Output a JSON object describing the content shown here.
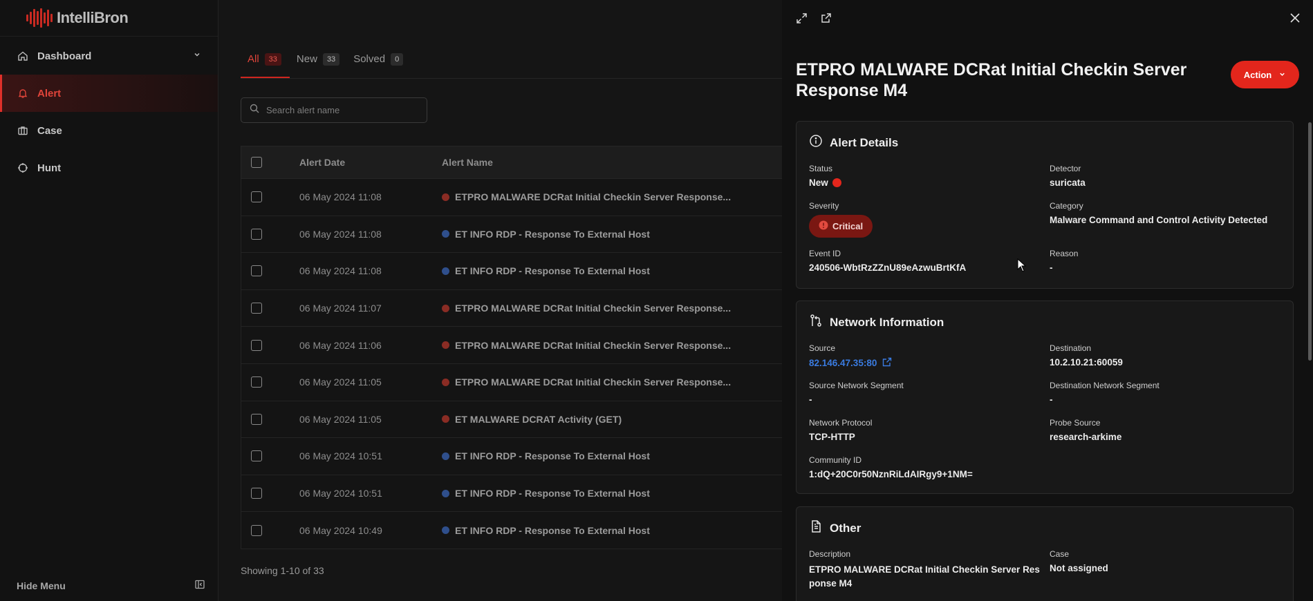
{
  "sidebar": {
    "logo_text": "IntelliBron",
    "items": [
      {
        "label": "Dashboard",
        "icon": "home-icon"
      },
      {
        "label": "Alert",
        "icon": "bell-icon"
      },
      {
        "label": "Case",
        "icon": "briefcase-icon"
      },
      {
        "label": "Hunt",
        "icon": "crosshair-icon"
      }
    ],
    "hide_menu": "Hide Menu"
  },
  "tabs": [
    {
      "label": "All",
      "count": "33"
    },
    {
      "label": "New",
      "count": "33"
    },
    {
      "label": "Solved",
      "count": "0"
    }
  ],
  "search": {
    "placeholder": "Search alert name"
  },
  "table": {
    "headers": {
      "date": "Alert Date",
      "name": "Alert Name"
    },
    "rows": [
      {
        "date": "06 May 2024 11:08",
        "name": "ETPRO MALWARE DCRat Initial Checkin Server Response...",
        "severity": "critical"
      },
      {
        "date": "06 May 2024 11:08",
        "name": "ET INFO RDP - Response To External Host",
        "severity": "info"
      },
      {
        "date": "06 May 2024 11:08",
        "name": "ET INFO RDP - Response To External Host",
        "severity": "info"
      },
      {
        "date": "06 May 2024 11:07",
        "name": "ETPRO MALWARE DCRat Initial Checkin Server Response...",
        "severity": "critical"
      },
      {
        "date": "06 May 2024 11:06",
        "name": "ETPRO MALWARE DCRat Initial Checkin Server Response...",
        "severity": "critical"
      },
      {
        "date": "06 May 2024 11:05",
        "name": "ETPRO MALWARE DCRat Initial Checkin Server Response...",
        "severity": "critical"
      },
      {
        "date": "06 May 2024 11:05",
        "name": "ET MALWARE DCRAT Activity (GET)",
        "severity": "critical"
      },
      {
        "date": "06 May 2024 10:51",
        "name": "ET INFO RDP - Response To External Host",
        "severity": "info"
      },
      {
        "date": "06 May 2024 10:51",
        "name": "ET INFO RDP - Response To External Host",
        "severity": "info"
      },
      {
        "date": "06 May 2024 10:49",
        "name": "ET INFO RDP - Response To External Host",
        "severity": "info"
      }
    ],
    "showing": "Showing 1-10 of 33"
  },
  "panel": {
    "title": "ETPRO MALWARE DCRat Initial Checkin Server Response M4",
    "action_label": "Action",
    "alert_details": {
      "heading": "Alert Details",
      "status_label": "Status",
      "status_value": "New",
      "detector_label": "Detector",
      "detector_value": "suricata",
      "severity_label": "Severity",
      "severity_value": "Critical",
      "category_label": "Category",
      "category_value": "Malware Command and Control Activity Detected",
      "event_id_label": "Event ID",
      "event_id_value": "240506-WbtRzZZnU89eAzwuBrtKfA",
      "reason_label": "Reason",
      "reason_value": "-"
    },
    "network": {
      "heading": "Network Information",
      "source_label": "Source",
      "source_value": "82.146.47.35:80",
      "destination_label": "Destination",
      "destination_value": "10.2.10.21:60059",
      "src_segment_label": "Source Network Segment",
      "src_segment_value": "-",
      "dst_segment_label": "Destination Network Segment",
      "dst_segment_value": "-",
      "protocol_label": "Network Protocol",
      "protocol_value": "TCP-HTTP",
      "probe_label": "Probe Source",
      "probe_value": "research-arkime",
      "community_label": "Community ID",
      "community_value": "1:dQ+20C0r50NznRiLdAIRgy9+1NM="
    },
    "other": {
      "heading": "Other",
      "description_label": "Description",
      "description_value": "ETPRO MALWARE DCRat Initial Checkin Server Res ponse M4",
      "case_label": "Case",
      "case_value": "Not assigned"
    }
  },
  "colors": {
    "accent": "#e3261c",
    "critical": "#8a2c24",
    "info": "#2f4f8c",
    "link": "#3a7be0"
  }
}
